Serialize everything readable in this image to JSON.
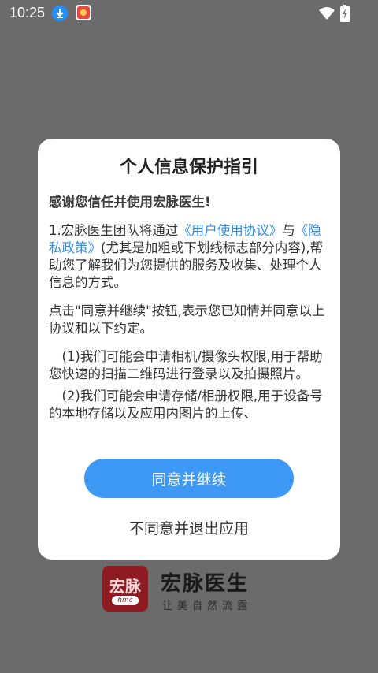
{
  "status_bar": {
    "time": "10:25",
    "icons": [
      "download-icon",
      "app-notification-icon",
      "wifi-icon",
      "battery-charging-icon"
    ]
  },
  "dialog": {
    "title": "个人信息保护指引",
    "thanks": "感谢您信任并使用宏脉医生!",
    "p1_prefix": "1.宏脉医生团队将通过",
    "link_terms": "《用户使用协议》",
    "p1_and": "与",
    "link_privacy": "《隐私政策》",
    "p1_suffix": "(尤其是加粗或下划线标志部分内容),帮助您了解我们为您提供的服务及收集、处理个人信息的方式。",
    "p2": "点击\"同意并继续\"按钮,表示您已知情并同意以上协议和以下约定。",
    "p3": "(1)我们可能会申请相机/摄像头权限,用于帮助您快速的扫描二维码进行登录以及拍摄照片。",
    "p4": "(2)我们可能会申请存储/相册权限,用于设备号的本地存储以及应用内图片的上传、",
    "agree_label": "同意并继续",
    "disagree_label": "不同意并退出应用"
  },
  "splash": {
    "logo_text": "宏脉",
    "logo_sub": "hmc",
    "app_name": "宏脉医生",
    "slogan": "让美自然流露"
  },
  "colors": {
    "overlay": "#6b6b6b",
    "accent": "#3d99f5",
    "link": "#2d8cf0",
    "logo": "#8f1b22"
  }
}
